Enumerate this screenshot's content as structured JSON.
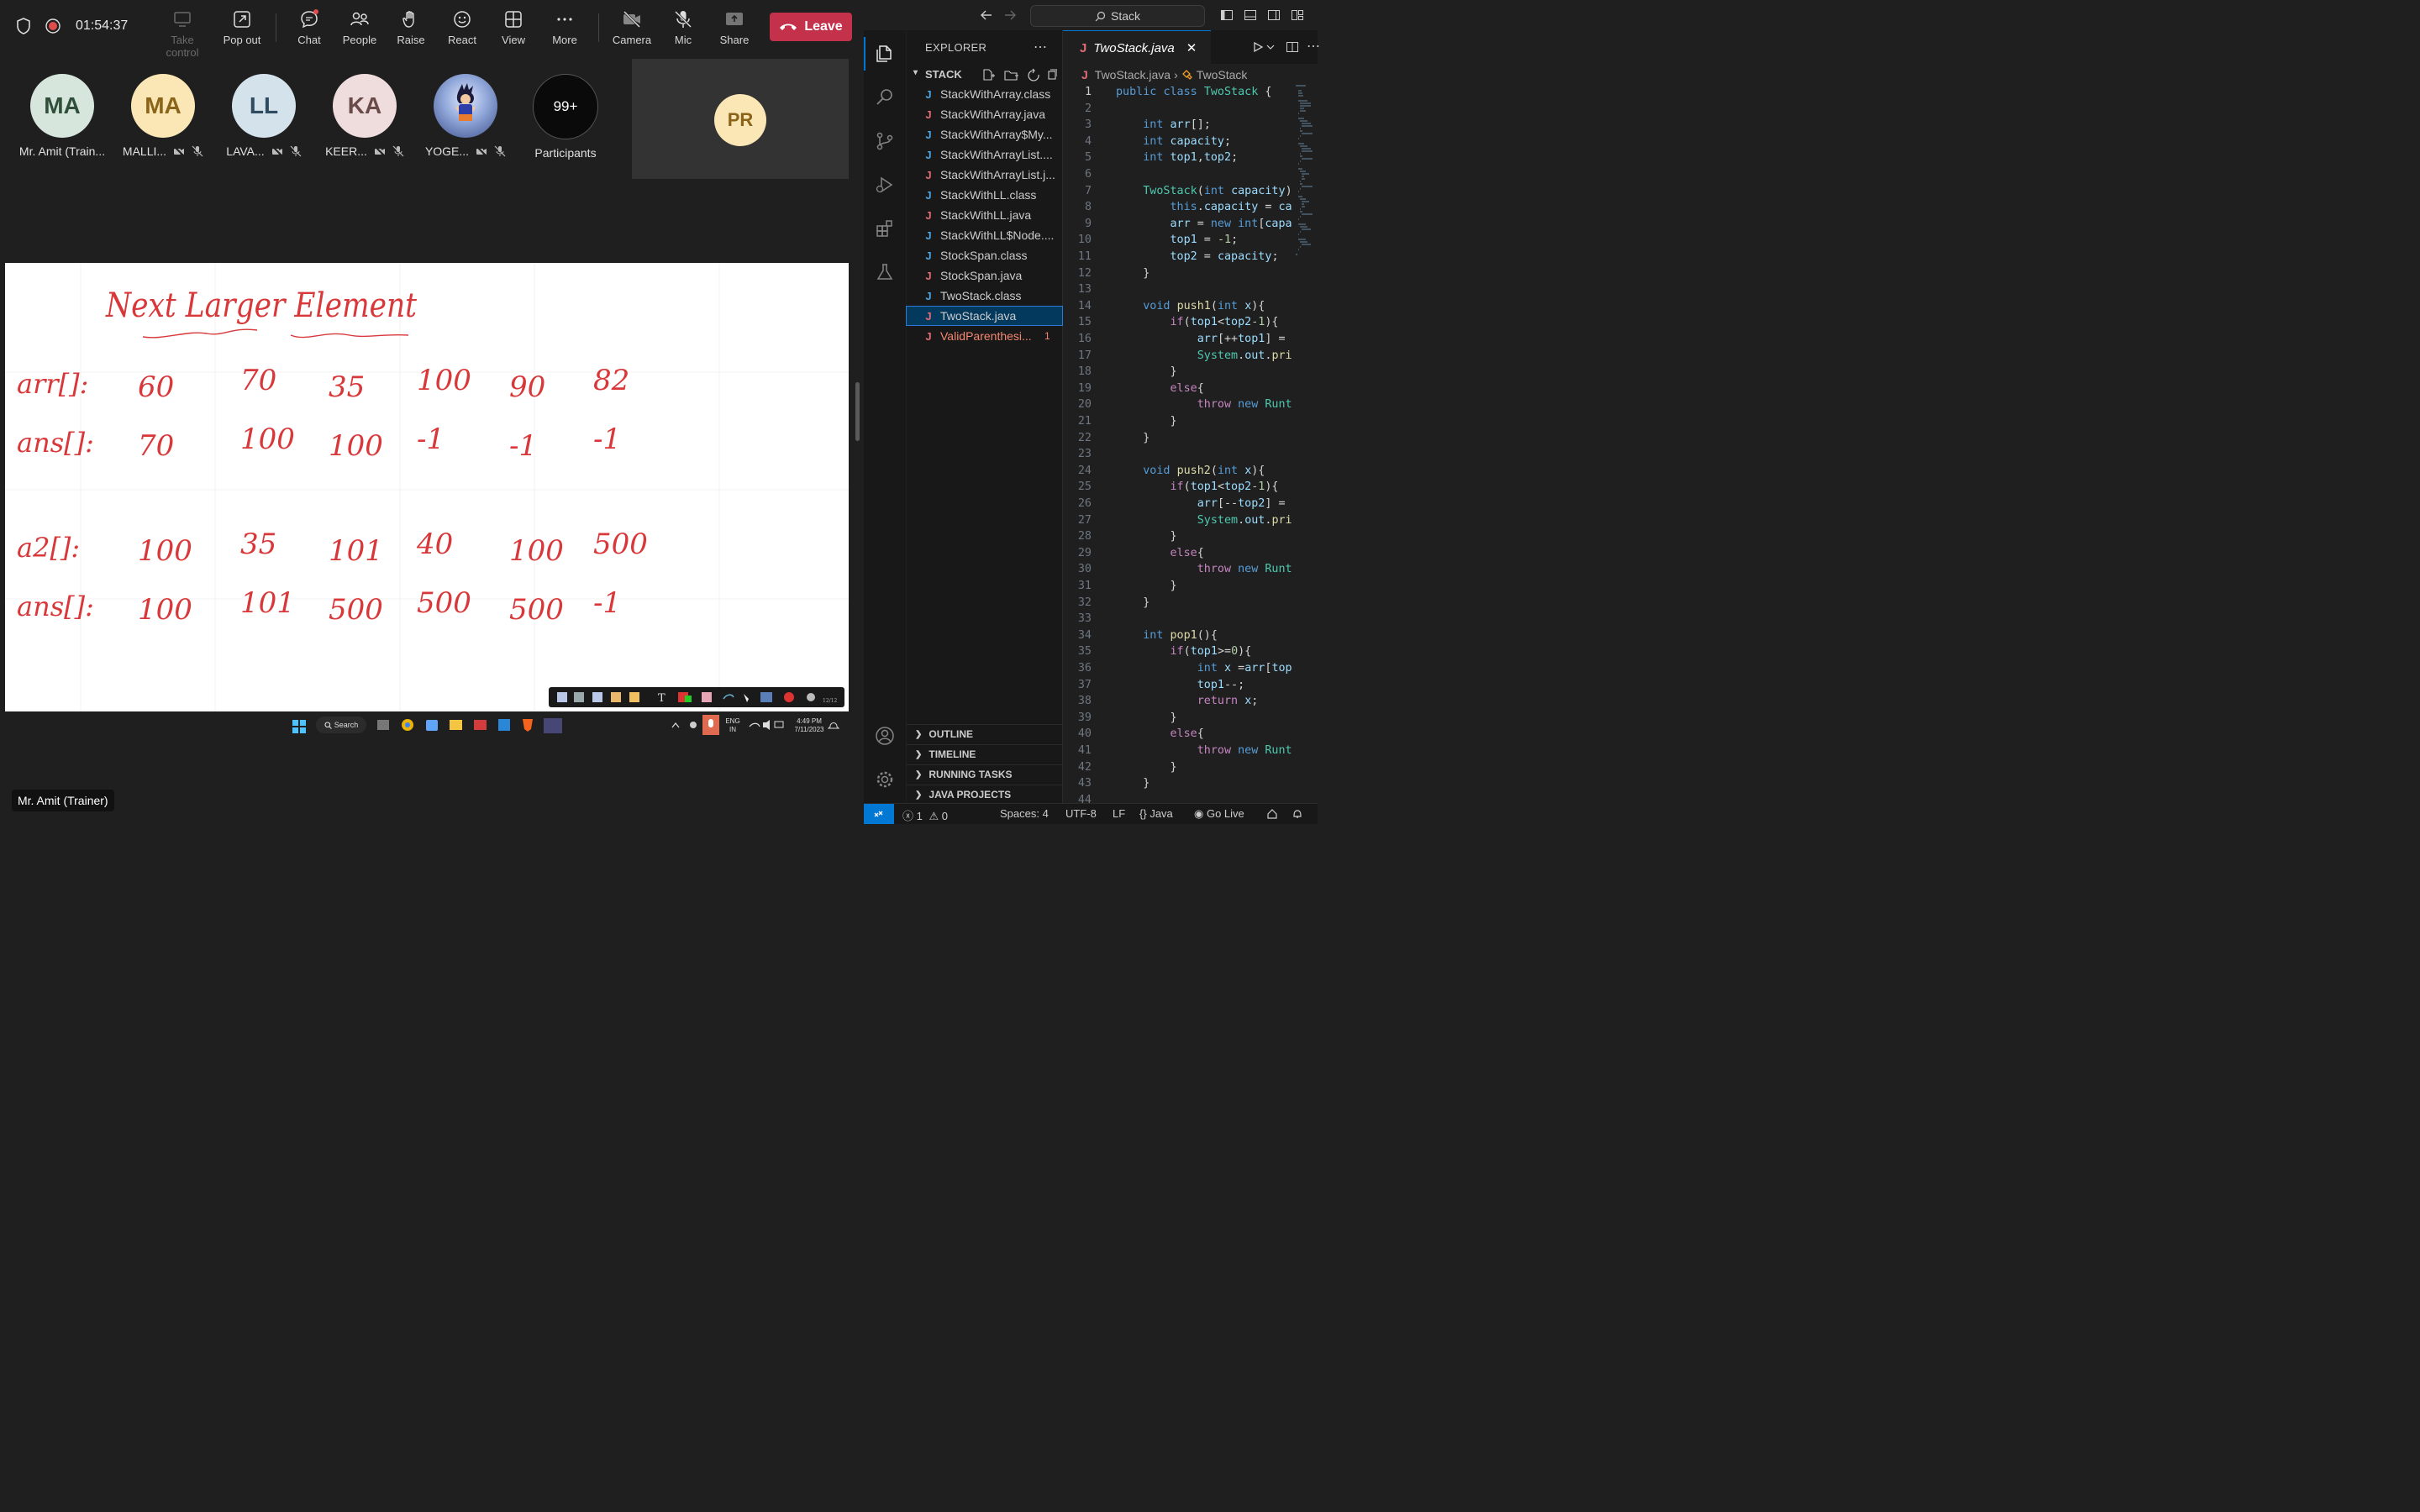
{
  "teams": {
    "timer": "01:54:37",
    "toolbar": {
      "take_control": "Take control",
      "pop_out": "Pop out",
      "chat": "Chat",
      "people": "People",
      "raise": "Raise",
      "react": "React",
      "view": "View",
      "more": "More",
      "camera": "Camera",
      "mic": "Mic",
      "share": "Share",
      "leave": "Leave"
    },
    "participants": [
      {
        "initials": "MA",
        "name": "Mr. Amit (Train...",
        "bg": "#d6e6dc",
        "fg": "#2f4f3a"
      },
      {
        "initials": "MA",
        "name": "MALLI...",
        "bg": "#fbe7b6",
        "fg": "#8a6418"
      },
      {
        "initials": "LL",
        "name": "LAVA...",
        "bg": "#d4e2ec",
        "fg": "#2e4b60"
      },
      {
        "initials": "KA",
        "name": "KEER...",
        "bg": "#efdcdc",
        "fg": "#6b4a4a"
      },
      {
        "initials": "",
        "name": "YOGE...",
        "bg": "#7e8fc4",
        "fg": "#ffffff"
      }
    ],
    "participants_count": "99+",
    "participants_label": "Participants",
    "tile_initials": "PR",
    "name_tag": "Mr. Amit (Trainer)",
    "whiteboard": {
      "title": "Next   Larger   Element",
      "rows": [
        {
          "label": "arr[]:",
          "values": [
            "60",
            "70",
            "35",
            "100",
            "90",
            "82"
          ]
        },
        {
          "label": "ans[]:",
          "values": [
            "70",
            "100",
            "100",
            "-1",
            "-1",
            "-1"
          ]
        },
        {
          "label": "a2[]:",
          "values": [
            "100",
            "35",
            "101",
            "40",
            "100",
            "500"
          ]
        },
        {
          "label": "ans[]:",
          "values": [
            "100",
            "101",
            "500",
            "500",
            "500",
            "-1"
          ]
        }
      ]
    },
    "taskbar": {
      "search": "Search",
      "lang_top": "ENG",
      "lang_bottom": "IN",
      "time": "4:49 PM",
      "date": "7/11/2023"
    }
  },
  "vscode": {
    "search_label": "Stack",
    "explorer_title": "EXPLORER",
    "folder": "STACK",
    "files": [
      {
        "name": "StackWithArray.class",
        "kind": "class"
      },
      {
        "name": "StackWithArray.java",
        "kind": "java"
      },
      {
        "name": "StackWithArray$My...",
        "kind": "class"
      },
      {
        "name": "StackWithArrayList....",
        "kind": "class"
      },
      {
        "name": "StackWithArrayList.j...",
        "kind": "java"
      },
      {
        "name": "StackWithLL.class",
        "kind": "class"
      },
      {
        "name": "StackWithLL.java",
        "kind": "java"
      },
      {
        "name": "StackWithLL$Node....",
        "kind": "class"
      },
      {
        "name": "StockSpan.class",
        "kind": "class"
      },
      {
        "name": "StockSpan.java",
        "kind": "java"
      },
      {
        "name": "TwoStack.class",
        "kind": "class"
      },
      {
        "name": "TwoStack.java",
        "kind": "java",
        "selected": true
      },
      {
        "name": "ValidParenthesi...",
        "kind": "java",
        "error": true,
        "badge": "1"
      }
    ],
    "sections": [
      "OUTLINE",
      "TIMELINE",
      "RUNNING TASKS",
      "JAVA PROJECTS"
    ],
    "tab_title": "TwoStack.java",
    "breadcrumb_file": "TwoStack.java",
    "breadcrumb_symbol": "TwoStack",
    "code": [
      "public class TwoStack {",
      "",
      "    int arr[];",
      "    int capacity;",
      "    int top1,top2;",
      "",
      "    TwoStack(int capacity)",
      "        this.capacity = ca",
      "        arr = new int[capa",
      "        top1 = -1;",
      "        top2 = capacity;",
      "    }",
      "",
      "    void push1(int x){",
      "        if(top1<top2-1){",
      "            arr[++top1] =",
      "            System.out.pri",
      "        }",
      "        else{",
      "            throw new Runt",
      "        }",
      "    }",
      "",
      "    void push2(int x){",
      "        if(top1<top2-1){",
      "            arr[--top2] =",
      "            System.out.pri",
      "        }",
      "        else{",
      "            throw new Runt",
      "        }",
      "    }",
      "",
      "    int pop1(){",
      "        if(top1>=0){",
      "            int x =arr[top",
      "            top1--;",
      "            return x;",
      "        }",
      "        else{",
      "            throw new Runt",
      "        }",
      "    }",
      ""
    ],
    "status": {
      "errors": "1",
      "warnings": "0",
      "spaces": "Spaces: 4",
      "encoding": "UTF-8",
      "eol": "LF",
      "language": "Java",
      "golive": "Go Live"
    }
  },
  "colors": {
    "leave": "#c4314b",
    "accent": "#0078d4",
    "ink": "#d9383a"
  }
}
